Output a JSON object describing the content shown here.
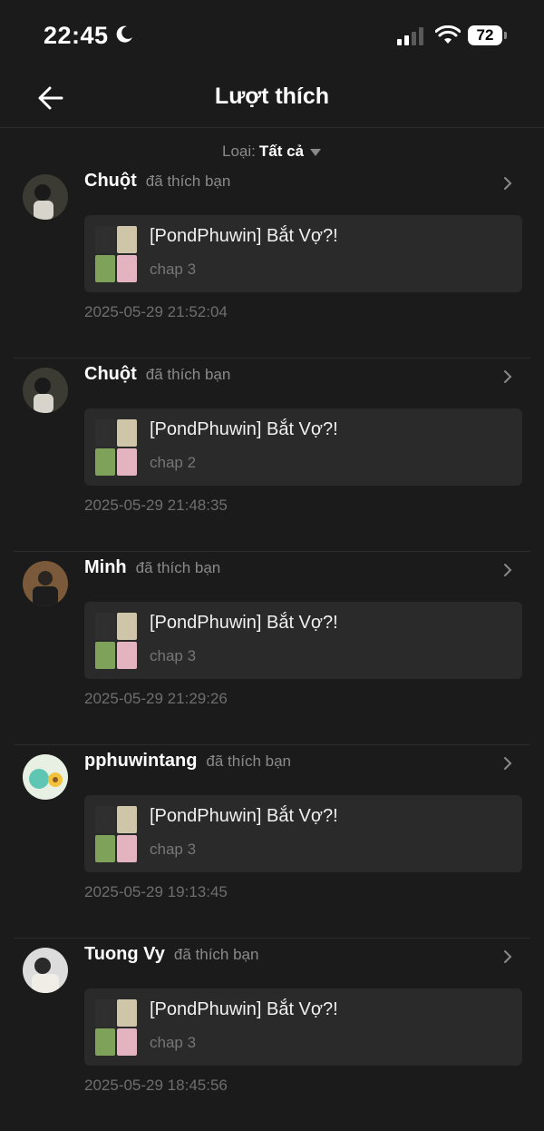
{
  "status": {
    "time": "22:45",
    "battery": "72"
  },
  "nav": {
    "title": "Lượt thích"
  },
  "filter": {
    "label": "Loại:",
    "value": "Tất cả"
  },
  "items": [
    {
      "name": "Chuột",
      "action": "đã thích bạn",
      "card_title": "[PondPhuwin] Bắt Vợ?!",
      "card_sub": "chap 3",
      "time": "2025-05-29 21:52:04"
    },
    {
      "name": "Chuột",
      "action": "đã thích bạn",
      "card_title": "[PondPhuwin] Bắt Vợ?!",
      "card_sub": "chap 2",
      "time": "2025-05-29 21:48:35"
    },
    {
      "name": "Minh",
      "action": "đã thích bạn",
      "card_title": "[PondPhuwin] Bắt Vợ?!",
      "card_sub": "chap 3",
      "time": "2025-05-29 21:29:26"
    },
    {
      "name": "pphuwintang",
      "action": "đã thích bạn",
      "card_title": "[PondPhuwin] Bắt Vợ?!",
      "card_sub": "chap 3",
      "time": "2025-05-29 19:13:45"
    },
    {
      "name": "Tuong Vy",
      "action": "đã thích bạn",
      "card_title": "[PondPhuwin] Bắt Vợ?!",
      "card_sub": "chap 3",
      "time": "2025-05-29 18:45:56"
    }
  ],
  "icons": {
    "back": "arrow-left-icon",
    "chevron": "chevron-right-icon",
    "caret": "caret-down-icon",
    "moon": "moon-icon",
    "signal": "cellular-signal-icon",
    "wifi": "wifi-icon"
  },
  "colors": {
    "background": "#1b1b1b",
    "card": "#2a2a2a",
    "muted": "#8a8a8a"
  }
}
